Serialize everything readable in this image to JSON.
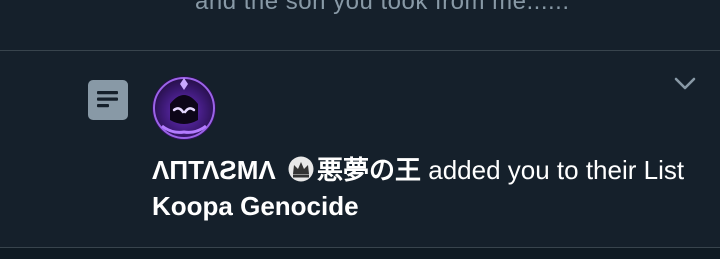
{
  "previous_notification": {
    "text": "and the son you took from me......"
  },
  "notification": {
    "type_icon": "list-icon",
    "caret_icon": "chevron-down-icon",
    "avatar_icon": "avatar-image",
    "user_name_part1": "ΛΠΤΛƧMΛ",
    "user_name_part2": "悪夢の王",
    "action_text": " added you to their List ",
    "list_name": "Koopa Genocide"
  },
  "colors": {
    "background": "#15202b",
    "secondary_text": "#8899a6",
    "divider": "#38444d",
    "avatar_accent": "#7b3fd0"
  }
}
